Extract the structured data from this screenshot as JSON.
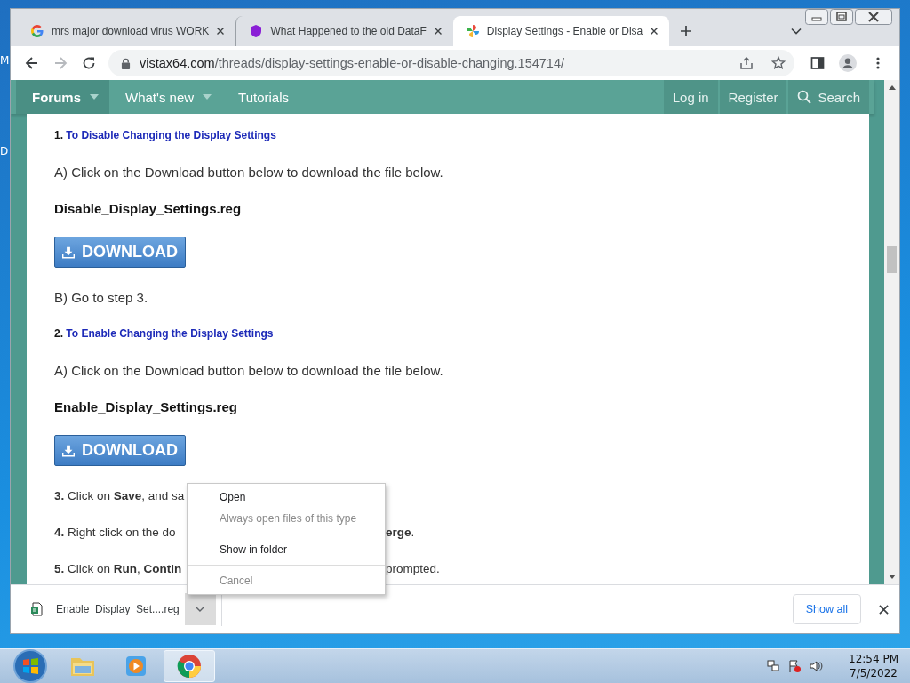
{
  "desktop_labels": [
    "M",
    "D"
  ],
  "tabs": [
    {
      "title": "mrs major download virus WORK",
      "selected": false
    },
    {
      "title": "What Happened to the old DataF",
      "selected": false
    },
    {
      "title": "Display Settings - Enable or Disa",
      "selected": true
    }
  ],
  "address": {
    "domain": "vistax64.com",
    "path": "/threads/display-settings-enable-or-disable-changing.154714/"
  },
  "nav": {
    "left": [
      {
        "label": "Forums",
        "selected": true,
        "dropdown": true
      },
      {
        "label": "What's new",
        "selected": false,
        "dropdown": true
      },
      {
        "label": "Tutorials",
        "selected": false,
        "dropdown": false
      }
    ],
    "right": [
      {
        "label": "Log in",
        "kind": "link"
      },
      {
        "label": "Register",
        "kind": "link"
      },
      {
        "label": "Search",
        "kind": "search"
      }
    ]
  },
  "content": [
    {
      "kind": "heading",
      "number": "1.",
      "text": "To Disable Changing the Display Settings"
    },
    {
      "kind": "paragraph",
      "text": "A) Click on the Download button below to download the file below."
    },
    {
      "kind": "filename",
      "text": "Disable_Display_Settings.reg"
    },
    {
      "kind": "download",
      "label": "DOWNLOAD"
    },
    {
      "kind": "paragraph",
      "text": "B) Go to step 3."
    },
    {
      "kind": "heading",
      "number": "2.",
      "text": "To Enable Changing the Display Settings"
    },
    {
      "kind": "paragraph",
      "text": "A) Click on the Download button below to download the file below."
    },
    {
      "kind": "filename",
      "text": "Enable_Display_Settings.reg"
    },
    {
      "kind": "download",
      "label": "DOWNLOAD"
    },
    {
      "kind": "step",
      "left": "**3.** Click on **Save**, and sa"
    },
    {
      "kind": "step",
      "left": "**4.** Right click on the do",
      "right": "**erge**."
    },
    {
      "kind": "step",
      "left": "**5.** Click on **Run**, **Contin**",
      "right": "prompted."
    }
  ],
  "context_menu": [
    [
      {
        "label": "Open",
        "disabled": false
      },
      {
        "label": "Always open files of this type",
        "disabled": true
      }
    ],
    [
      {
        "label": "Show in folder",
        "disabled": false
      }
    ],
    [
      {
        "label": "Cancel",
        "disabled": true
      }
    ]
  ],
  "download_bar": {
    "file": "Enable_Display_Set....reg",
    "show_all": "Show all"
  },
  "taskbar": {
    "apps": [
      {
        "kind": "explorer",
        "selected": false
      },
      {
        "kind": "media",
        "selected": false
      },
      {
        "kind": "chrome",
        "selected": true
      }
    ],
    "time": "12:54 PM",
    "date": "7/5/2022"
  }
}
